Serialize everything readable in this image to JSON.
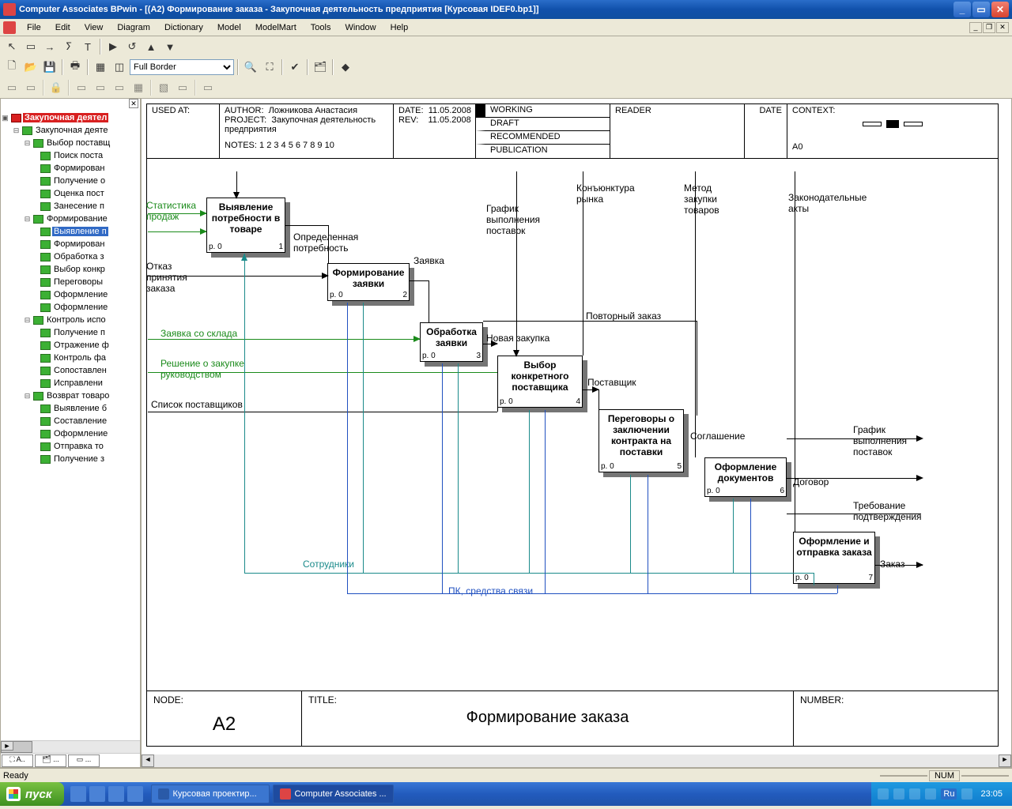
{
  "title": "Computer Associates BPwin - [(А2) Формирование  заказа - Закупочная деятельность предприятия  [Курсовая IDEF0.bp1]]",
  "menus": [
    "File",
    "Edit",
    "View",
    "Diagram",
    "Dictionary",
    "Model",
    "ModelMart",
    "Tools",
    "Window",
    "Help"
  ],
  "combo_value": "Full Border",
  "tree": {
    "root": "Закупочная деятел",
    "n0": "Закупочная деяте",
    "n0_0": "Выбор поставщ",
    "n0_0_0": "Поиск поста",
    "n0_0_1": "Формирован",
    "n0_0_2": "Получение о",
    "n0_0_3": "Оценка пост",
    "n0_0_4": "Занесение п",
    "n0_1": "Формирование",
    "n0_1_0": "Выявление п",
    "n0_1_1": "Формирован",
    "n0_1_2": "Обработка з",
    "n0_1_3": "Выбор конкр",
    "n0_1_4": "Переговоры",
    "n0_1_5": "Оформление",
    "n0_1_6": "Оформление",
    "n0_2": "Контроль испо",
    "n0_2_0": "Получение п",
    "n0_2_1": "Отражение ф",
    "n0_2_2": "Контроль фа",
    "n0_2_3": "Сопоставлен",
    "n0_2_4": "Исправлени",
    "n0_3": "Возврат товаро",
    "n0_3_0": "Выявление б",
    "n0_3_1": "Составление",
    "n0_3_2": "Оформление",
    "n0_3_3": "Отправка то",
    "n0_3_4": "Получение з"
  },
  "header": {
    "used_at": "USED AT:",
    "author_lbl": "AUTHOR:",
    "author": "Ложникова Анастасия",
    "project_lbl": "PROJECT:",
    "project": "Закупочная деятельность предприятия",
    "notes_lbl": "NOTES:",
    "notes": "1  2  3  4  5  6  7  8  9  10",
    "date_lbl": "DATE:",
    "date": "11.05.2008",
    "rev_lbl": "REV:",
    "rev": "11.05.2008",
    "working": "WORKING",
    "draft": "DRAFT",
    "recommended": "RECOMMENDED",
    "publication": "PUBLICATION",
    "reader": "READER",
    "rdate": "DATE",
    "context": "CONTEXT:",
    "context_ref": "A0"
  },
  "footer": {
    "node_lbl": "NODE:",
    "node": "A2",
    "title_lbl": "TITLE:",
    "title": "Формирование  заказа",
    "number_lbl": "NUMBER:"
  },
  "acts": {
    "a1": "Выявление потребности в товаре",
    "a2": "Формирование заявки",
    "a3": "Обработка заявки",
    "a4": "Выбор конкретного поставщика",
    "a5": "Переговоры о  заключении контракта на поставки",
    "a6": "Оформление документов",
    "a7": "Оформление и отправка заказа",
    "p0": "p. 0",
    "n1": "1",
    "n2": "2",
    "n3": "3",
    "n4": "4",
    "n5": "5",
    "n6": "6",
    "n7": "7"
  },
  "labels": {
    "stat_sales": "Статистика\nпродаж",
    "refusal": "Отказ\nпринятия\nзаказа",
    "defined_need": "Определенная\nпотребность",
    "request": "Заявка",
    "schedule_in": "График\nвыполнения\nпоставок",
    "market": "Конъюнктура\nрынка",
    "method": "Метод\nзакупки\nтоваров",
    "laws": "Законодательные\nакты",
    "wh_request": "Заявка со склада",
    "mgmt_decision": "Решение о закупке\nруководством",
    "supplier_list": "Список поставщиков",
    "new_purchase": "Новая закупка",
    "reorder": "Повторный заказ",
    "supplier": "Поставщик",
    "agreement": "Соглашение",
    "schedule_out": "График\nвыполнения\nпоставок",
    "contract": "Договор",
    "confirm_req": "Требование\nподтверждения",
    "order": "Заказ",
    "employees": "Сотрудники",
    "pc_comm": "ПК, средства связи"
  },
  "status": {
    "ready": "Ready",
    "num": "NUM"
  },
  "taskbar": {
    "start": "пуск",
    "task1": "Курсовая проектир...",
    "task2": "Computer Associates ...",
    "lang": "Ru",
    "clock": "23:05"
  }
}
